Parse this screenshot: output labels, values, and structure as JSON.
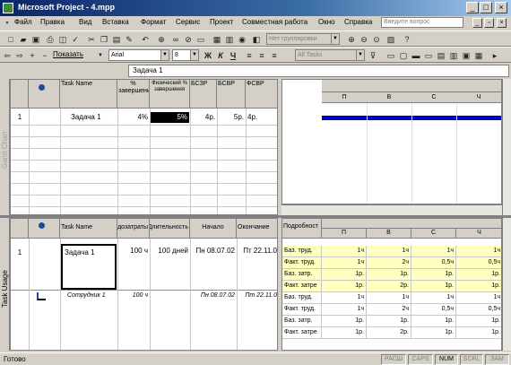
{
  "window": {
    "title": "Microsoft Project - 4.mpp"
  },
  "menu": [
    "Файл",
    "Правка",
    "Вид",
    "Вставка",
    "Формат",
    "Сервис",
    "Проект",
    "Совместная работа",
    "Окно",
    "Справка"
  ],
  "help_placeholder": "Введите вопрос",
  "toolbar": {
    "group_combo": "Нет группировки",
    "show_button": "Показать",
    "font": "Arial",
    "font_size": "8",
    "bold": "Ж",
    "italic": "К",
    "underline": "Ч",
    "filter_combo": "All Tasks"
  },
  "entry_bar": {
    "value": "Задача 1"
  },
  "top_pane": {
    "side_label": "Gantt Chart",
    "headers": {
      "task_name": "Task Name",
      "pct_complete": "% завершения",
      "physical_pct": "Физический % завершения",
      "bcws": "БСЗР",
      "bcwp": "БСВР",
      "acwp": "ФСВР"
    },
    "rows": [
      {
        "id": "1",
        "task_name": "Задача 1",
        "pct_complete": "4%",
        "physical_pct": "5%",
        "bcws": "4р.",
        "bcwp": "5р.",
        "acwp": "4р."
      }
    ],
    "timeline_days": [
      "П",
      "В",
      "С",
      "Ч"
    ],
    "accent": "#0000cc"
  },
  "bottom_pane": {
    "side_label": "Task Usage",
    "headers": {
      "task_name": "Task Name",
      "work": "Трудозатраты",
      "duration": "Длительность",
      "start": "Начало",
      "finish": "Окончание"
    },
    "rows": [
      {
        "id": "1",
        "task_name": "Задача 1",
        "work": "100 ч",
        "duration": "100 дней",
        "start": "Пн 08.07.02",
        "finish": "Пт 22.11.0"
      },
      {
        "id": "",
        "task_name": "Сотрудник 1",
        "work": "100 ч",
        "duration": "",
        "start": "Пн 08.07.02",
        "finish": "Пт 22.11.0"
      }
    ],
    "details_label": "Подробност",
    "days": [
      "П",
      "В",
      "С",
      "Ч"
    ],
    "detail_rows": [
      {
        "label": "Баз. труд.",
        "values": [
          "1ч",
          "1ч",
          "1ч",
          "1ч"
        ],
        "highlight": true
      },
      {
        "label": "Факт. труд.",
        "values": [
          "1ч",
          "2ч",
          "0,5ч",
          "0,5ч"
        ],
        "highlight": true
      },
      {
        "label": "Баз. затр.",
        "values": [
          "1р.",
          "1р.",
          "1р.",
          "1р."
        ],
        "highlight": true
      },
      {
        "label": "Факт. затре",
        "values": [
          "1р.",
          "2р.",
          "1р.",
          "1р."
        ],
        "highlight": true
      },
      {
        "label": "Баз. труд.",
        "values": [
          "1ч",
          "1ч",
          "1ч",
          "1ч"
        ],
        "highlight": false
      },
      {
        "label": "Факт. труд.",
        "values": [
          "1ч",
          "2ч",
          "0,5ч",
          "0,5ч"
        ],
        "highlight": false
      },
      {
        "label": "Баз. затр.",
        "values": [
          "1р.",
          "1р.",
          "1р.",
          "1р."
        ],
        "highlight": false
      },
      {
        "label": "Факт. затре",
        "values": [
          "1р.",
          "2р.",
          "1р.",
          "1р."
        ],
        "highlight": false
      }
    ],
    "highlight_color": "#ffffc0"
  },
  "status": {
    "ready": "Готово",
    "indicators": [
      "РАСШ",
      "CAPS",
      "NUM",
      "SCRL",
      "ЗАМ"
    ]
  }
}
